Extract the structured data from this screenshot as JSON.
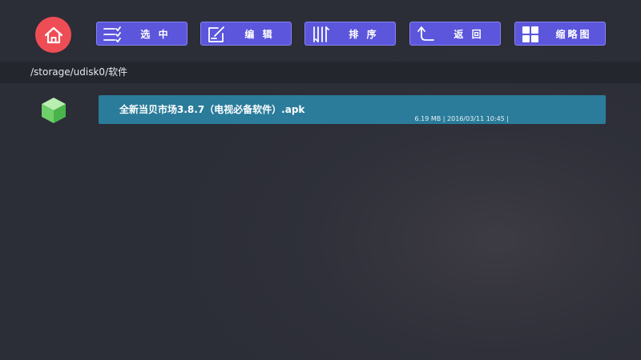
{
  "toolbar": {
    "home_icon": "home-icon",
    "buttons": [
      {
        "label": "选 中",
        "icon": "select-list-icon"
      },
      {
        "label": "编 辑",
        "icon": "edit-icon"
      },
      {
        "label": "排 序",
        "icon": "sort-icon"
      },
      {
        "label": "返 回",
        "icon": "back-arrow-icon"
      },
      {
        "label": "缩略图",
        "icon": "thumbnail-grid-icon"
      }
    ]
  },
  "path": "/storage/udisk0/软件",
  "files": [
    {
      "name": "全新当贝市场3.8.7（电视必备软件）.apk",
      "meta": "6.19 MB | 2016/03/11 10:45 |",
      "icon": "apk-package-icon",
      "selected": true
    }
  ],
  "colors": {
    "home_button": "#ee4d55",
    "toolbar_button": "#5b56dc",
    "selected_row": "#2b7c9b",
    "path_bar": "#24262e"
  }
}
